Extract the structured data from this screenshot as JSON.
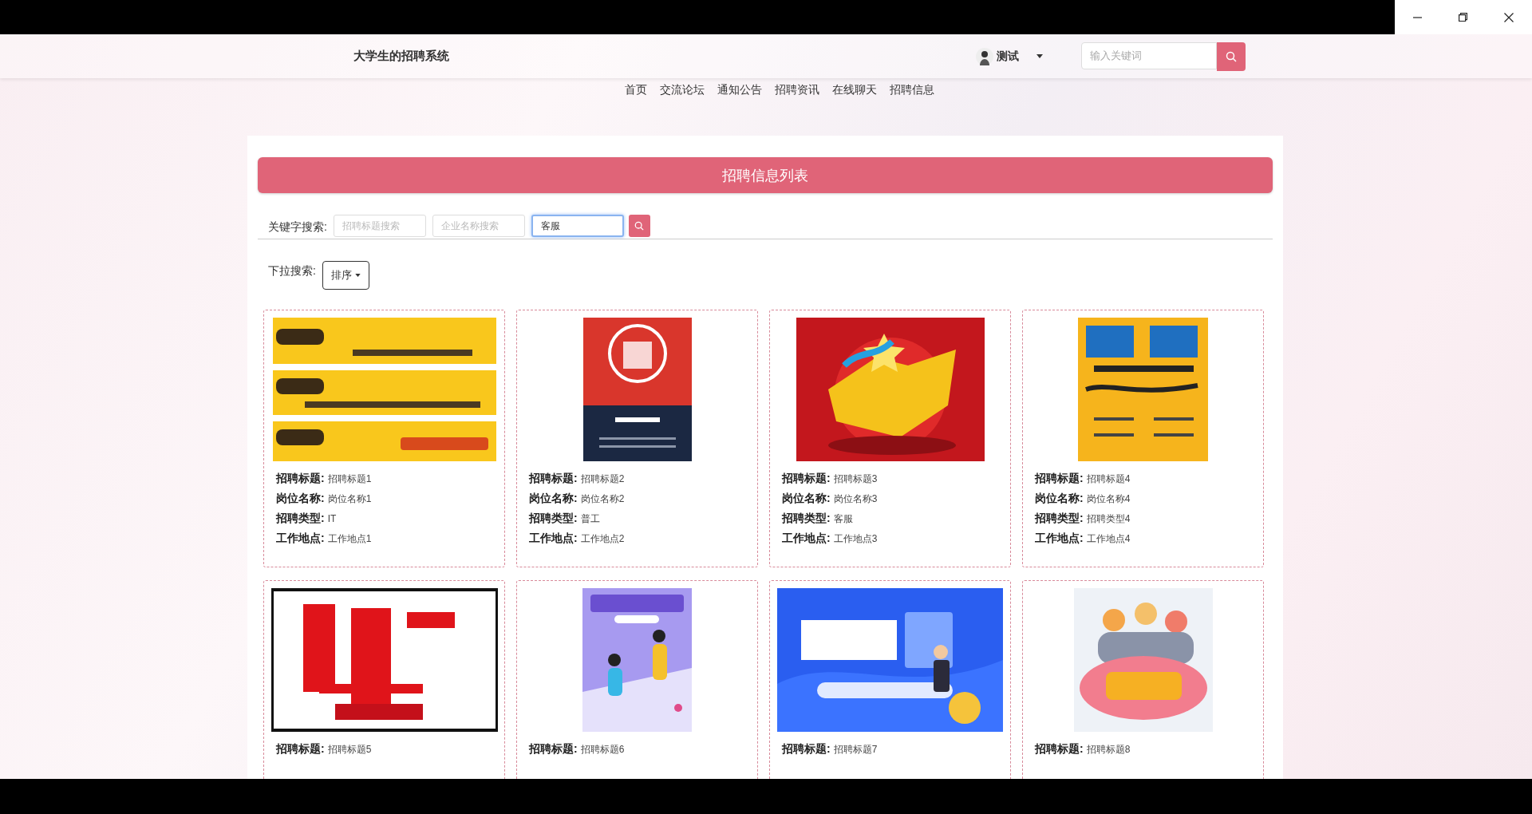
{
  "window_controls": [
    {
      "kind": "minimize"
    },
    {
      "kind": "restore"
    },
    {
      "kind": "close"
    }
  ],
  "header": {
    "site_title": "大学生的招聘系统",
    "user": {
      "name": "测试"
    },
    "search": {
      "placeholder": "输入关键词"
    }
  },
  "nav": [
    "首页",
    "交流论坛",
    "通知公告",
    "招聘资讯",
    "在线聊天",
    "招聘信息"
  ],
  "panel": {
    "title": "招聘信息列表",
    "keyword_search": {
      "label": "关键字搜索:",
      "fields": [
        {
          "placeholder": "招聘标题搜索",
          "focused": false
        },
        {
          "placeholder": "企业名称搜索",
          "focused": false
        },
        {
          "value": "客服",
          "focused": true
        }
      ]
    },
    "dropdown_search": {
      "label": "下拉搜索:",
      "button": "排序"
    },
    "cards": [
      {
        "fields": [
          {
            "label": "招聘标题:",
            "value": "招聘标题1"
          },
          {
            "label": "岗位名称:",
            "value": "岗位名称1"
          },
          {
            "label": "招聘类型:",
            "value": "IT"
          },
          {
            "label": "工作地点:",
            "value": "工作地点1"
          }
        ]
      },
      {
        "fields": [
          {
            "label": "招聘标题:",
            "value": "招聘标题2"
          },
          {
            "label": "岗位名称:",
            "value": "岗位名称2"
          },
          {
            "label": "招聘类型:",
            "value": "普工"
          },
          {
            "label": "工作地点:",
            "value": "工作地点2"
          }
        ]
      },
      {
        "fields": [
          {
            "label": "招聘标题:",
            "value": "招聘标题3"
          },
          {
            "label": "岗位名称:",
            "value": "岗位名称3"
          },
          {
            "label": "招聘类型:",
            "value": "客服"
          },
          {
            "label": "工作地点:",
            "value": "工作地点3"
          }
        ]
      },
      {
        "fields": [
          {
            "label": "招聘标题:",
            "value": "招聘标题4"
          },
          {
            "label": "岗位名称:",
            "value": "岗位名称4"
          },
          {
            "label": "招聘类型:",
            "value": "招聘类型4"
          },
          {
            "label": "工作地点:",
            "value": "工作地点4"
          }
        ]
      },
      {
        "fields": [
          {
            "label": "招聘标题:",
            "value": "招聘标题5"
          }
        ]
      },
      {
        "fields": [
          {
            "label": "招聘标题:",
            "value": "招聘标题6"
          }
        ]
      },
      {
        "fields": [
          {
            "label": "招聘标题:",
            "value": "招聘标题7"
          }
        ]
      },
      {
        "fields": [
          {
            "label": "招聘标题:",
            "value": "招聘标题8"
          }
        ]
      }
    ]
  }
}
